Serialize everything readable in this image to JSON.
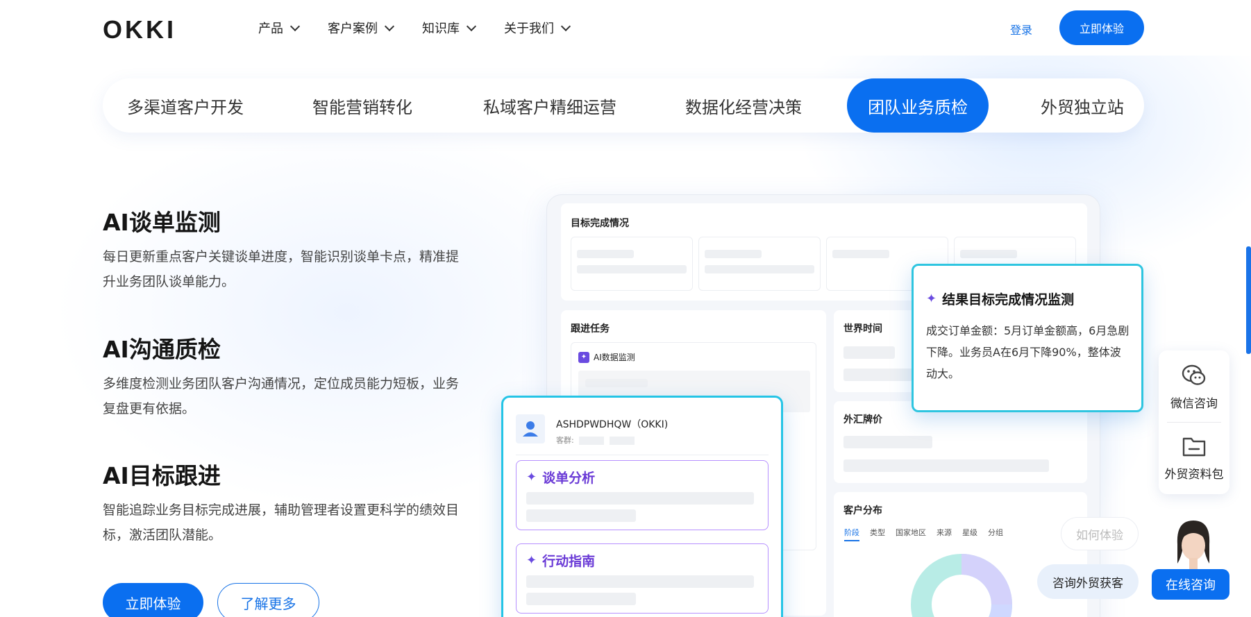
{
  "header": {
    "logo": "OKKI",
    "nav": [
      {
        "label": "产品"
      },
      {
        "label": "客户案例"
      },
      {
        "label": "知识库"
      },
      {
        "label": "关于我们"
      }
    ],
    "login": "登录",
    "cta": "立即体验"
  },
  "tabs": [
    {
      "label": "多渠道客户开发"
    },
    {
      "label": "智能营销转化"
    },
    {
      "label": "私域客户精细运营"
    },
    {
      "label": "数据化经营决策"
    },
    {
      "label": "团队业务质检",
      "active": true
    },
    {
      "label": "外贸独立站"
    }
  ],
  "features": [
    {
      "title": "AI谈单监测",
      "desc": "每日更新重点客户关键谈单进度，智能识别谈单卡点，精准提升业务团队谈单能力。"
    },
    {
      "title": "AI沟通质检",
      "desc": "多维度检测业务团队客户沟通情况，定位成员能力短板，业务复盘更有依据。"
    },
    {
      "title": "AI目标跟进",
      "desc": "智能追踪业务目标完成进展，辅助管理者设置更科学的绩效目标，激活团队潜能。"
    }
  ],
  "buttons": {
    "primary": "立即体验",
    "secondary": "了解更多"
  },
  "dashboard": {
    "goal_title": "目标完成情况",
    "followup_title": "跟进任务",
    "ai_monitor": "AI数据监测",
    "world_time": "世界时间",
    "fx_rate": "外汇牌价",
    "customer_dist": "客户分布",
    "dist_tabs": [
      "阶段",
      "类型",
      "国家地区",
      "来源",
      "星级",
      "分组"
    ]
  },
  "float_card": {
    "title": "结果目标完成情况监测",
    "desc": "成交订单金额：5月订单金额高，6月急剧下降。业务员A在6月下降90%，整体波动大。"
  },
  "customer_card": {
    "name": "ASHDPWDHQW（OKKI)",
    "group_label": "客群:",
    "analysis": "谈单分析",
    "guide": "行动指南"
  },
  "side_widget": {
    "wechat": "微信咨询",
    "pack": "外贸资料包"
  },
  "chat": {
    "bubble1": "如何体验",
    "bubble2": "咨询外贸获客",
    "online": "在线咨询"
  }
}
